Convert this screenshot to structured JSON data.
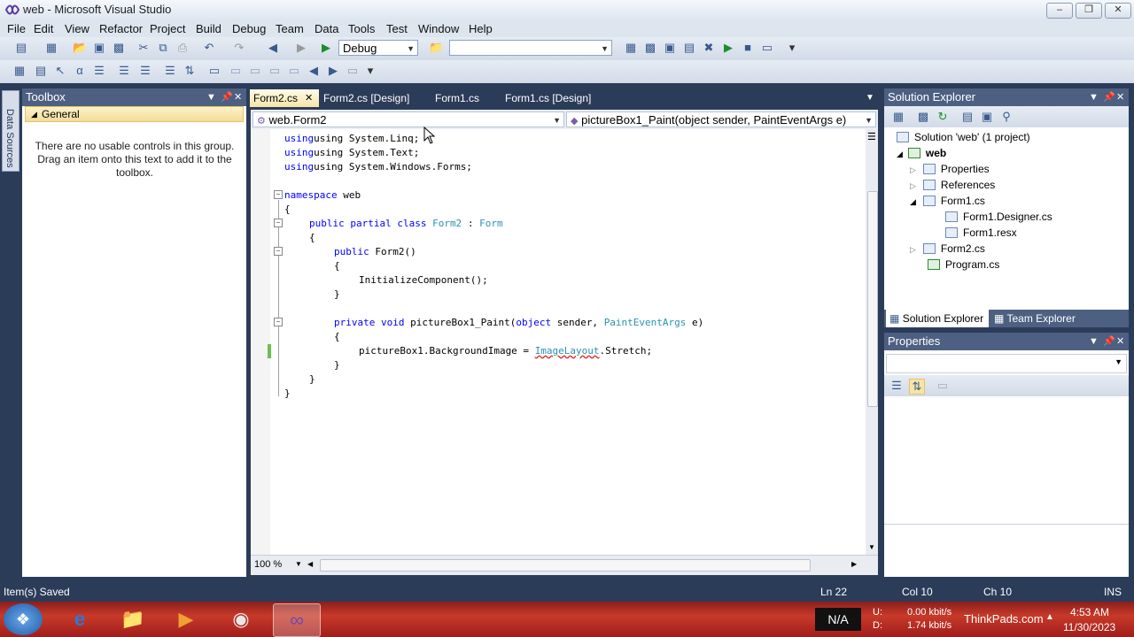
{
  "window": {
    "title": "web - Microsoft Visual Studio"
  },
  "menu": [
    "File",
    "Edit",
    "View",
    "Refactor",
    "Project",
    "Build",
    "Debug",
    "Team",
    "Data",
    "Tools",
    "Test",
    "Window",
    "Help"
  ],
  "toolbar": {
    "config_value": "Debug",
    "platform_value": ""
  },
  "side_strip": {
    "label": "Data Sources"
  },
  "toolbox": {
    "title": "Toolbox",
    "group": "General",
    "message_line1": "There are no usable controls in this group.",
    "message_line2": "Drag an item onto this text to add it to the",
    "message_line3": "toolbox."
  },
  "tabs": [
    "Form2.cs",
    "Form2.cs [Design]",
    "Form1.cs",
    "Form1.cs [Design]"
  ],
  "editor": {
    "type_nav": "web.Form2",
    "member_nav": "pictureBox1_Paint(object sender, PaintEventArgs e)",
    "zoom": "100 %"
  },
  "code": {
    "l1": "using System.Linq;",
    "l2": "using System.Text;",
    "l3": "using System.Windows.Forms;",
    "ns_kw": "namespace",
    "ns_name": " web",
    "brace_open": "{",
    "brace_close": "}",
    "cls_kw": "public partial class",
    "cls_name": "Form2",
    "cls_sep": " : ",
    "cls_base": "Form",
    "ctor_kw": "public",
    "ctor_name": " Form2()",
    "init_call": "InitializeComponent();",
    "meth_kw": "private void",
    "meth_name": " pictureBox1_Paint(",
    "meth_obj": "object",
    "meth_sender": " sender, ",
    "meth_type": "PaintEventArgs",
    "meth_end": " e)",
    "stmt_a": "pictureBox1.BackgroundImage = ",
    "stmt_err": "ImageLayout",
    "stmt_b": ".Stretch;"
  },
  "solution_explorer": {
    "title": "Solution Explorer",
    "solution": "Solution 'web' (1 project)",
    "project": "web",
    "items": [
      "Properties",
      "References",
      "Form1.cs",
      "Form1.Designer.cs",
      "Form1.resx",
      "Form2.cs",
      "Program.cs"
    ],
    "tab_solution": "Solution Explorer",
    "tab_team": "Team Explorer"
  },
  "properties": {
    "title": "Properties"
  },
  "status": {
    "message": "Item(s) Saved",
    "ln": "Ln 22",
    "col": "Col 10",
    "ch": "Ch 10",
    "mode": "INS"
  },
  "taskbar": {
    "na": "N/A",
    "up_label": "U:",
    "down_label": "D:",
    "up_rate": "0.00 kbit/s",
    "down_rate": "1.74 kbit/s",
    "brand": "ThinkPads.com",
    "time": "4:53 AM",
    "date": "11/30/2023"
  },
  "colors": {
    "keyword": "#0000ff",
    "type": "#2b91af",
    "panel_header": "#4d6082",
    "chrome": "#2b3c59"
  }
}
